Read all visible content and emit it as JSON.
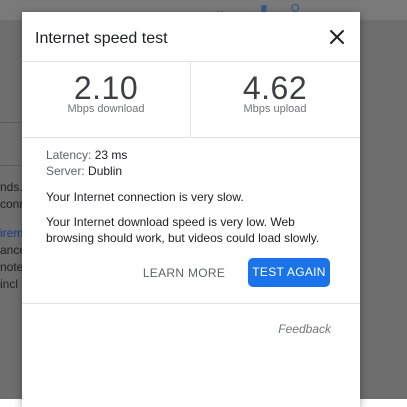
{
  "dialog": {
    "title": "Internet speed test",
    "close_label": "×",
    "download": {
      "value": "2.10",
      "unit": "Mbps download"
    },
    "upload": {
      "value": "4.62",
      "unit": "Mbps upload"
    },
    "latency": {
      "label": "Latency:",
      "value": "23 ms"
    },
    "server": {
      "label": "Server:",
      "value": "Dublin"
    },
    "message_primary": "Your Internet connection is very slow.",
    "message_secondary": "Your Internet download speed is very low. Web browsing should work, but videos could load slowly.",
    "learn_more_label": "LEARN MORE",
    "test_again_label": "TEST AGAIN",
    "feedback_label": "Feedback"
  },
  "background": {
    "fragments": [
      "nds.",
      "conn",
      "irem",
      "ance",
      "note",
      "incl"
    ]
  },
  "colors": {
    "primary_button": "#1a73e8",
    "overlay": "#6e6e6e"
  }
}
